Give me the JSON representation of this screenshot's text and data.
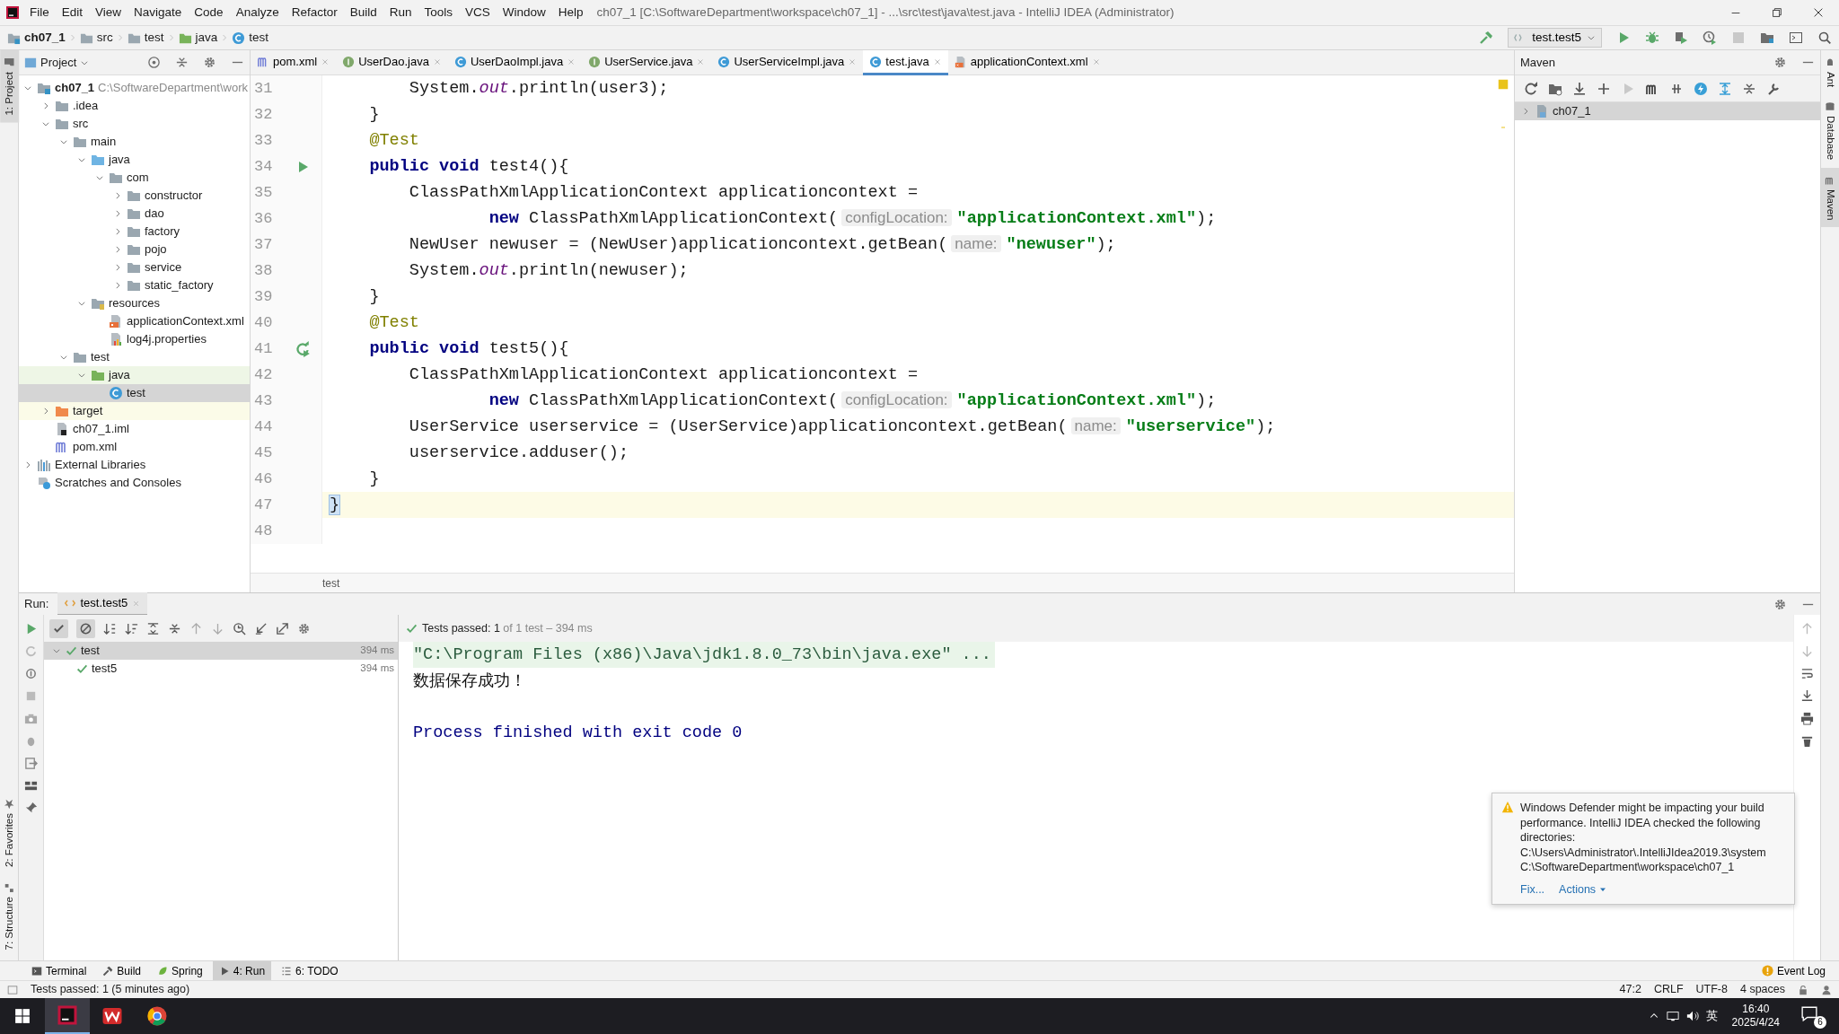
{
  "title_bar": {
    "menu": [
      "File",
      "Edit",
      "View",
      "Navigate",
      "Code",
      "Analyze",
      "Refactor",
      "Build",
      "Run",
      "Tools",
      "VCS",
      "Window",
      "Help"
    ],
    "title": "ch07_1 [C:\\SoftwareDepartment\\workspace\\ch07_1] - ...\\src\\test\\java\\test.java - IntelliJ IDEA (Administrator)"
  },
  "nav_bar": {
    "breadcrumbs": [
      {
        "label": "ch07_1",
        "kind": "module"
      },
      {
        "label": "src",
        "kind": "folder"
      },
      {
        "label": "test",
        "kind": "folder"
      },
      {
        "label": "java",
        "kind": "test-src"
      },
      {
        "label": "test",
        "kind": "class"
      }
    ],
    "run_config": "test.test5"
  },
  "left_stripe": {
    "top": [
      {
        "label": "1: Project",
        "selected": true
      }
    ],
    "bottom": [
      {
        "label": "2: Favorites",
        "selected": false
      },
      {
        "label": "7: Structure",
        "selected": false
      }
    ]
  },
  "right_stripe": [
    {
      "label": "Ant",
      "selected": false
    },
    {
      "label": "Database",
      "selected": false
    },
    {
      "label": "Maven",
      "selected": true
    }
  ],
  "project": {
    "title": "Project",
    "tree": [
      {
        "label": "ch07_1",
        "path": "C:\\SoftwareDepartment\\work",
        "kind": "module",
        "expanded": true,
        "selected": false,
        "children": [
          {
            "label": ".idea",
            "kind": "folder",
            "expanded": false,
            "selected": false
          },
          {
            "label": "src",
            "kind": "folder",
            "expanded": true,
            "selected": false,
            "children": [
              {
                "label": "main",
                "kind": "folder",
                "expanded": true,
                "selected": false,
                "children": [
                  {
                    "label": "java",
                    "kind": "src",
                    "expanded": true,
                    "selected": false,
                    "children": [
                      {
                        "label": "com",
                        "kind": "folder",
                        "expanded": true,
                        "selected": false,
                        "children": [
                          {
                            "label": "constructor",
                            "kind": "folder",
                            "expanded": false,
                            "selected": false
                          },
                          {
                            "label": "dao",
                            "kind": "folder",
                            "expanded": false,
                            "selected": false
                          },
                          {
                            "label": "factory",
                            "kind": "folder",
                            "expanded": false,
                            "selected": false
                          },
                          {
                            "label": "pojo",
                            "kind": "folder",
                            "expanded": false,
                            "selected": false
                          },
                          {
                            "label": "service",
                            "kind": "folder",
                            "expanded": false,
                            "selected": false
                          },
                          {
                            "label": "static_factory",
                            "kind": "folder",
                            "expanded": false,
                            "selected": false
                          }
                        ]
                      }
                    ]
                  },
                  {
                    "label": "resources",
                    "kind": "resources",
                    "expanded": true,
                    "selected": false,
                    "children": [
                      {
                        "label": "applicationContext.xml",
                        "kind": "xml",
                        "selected": false
                      },
                      {
                        "label": "log4j.properties",
                        "kind": "properties",
                        "selected": false
                      }
                    ]
                  }
                ]
              },
              {
                "label": "test",
                "kind": "folder",
                "expanded": true,
                "selected": false,
                "children": [
                  {
                    "label": "java",
                    "kind": "test-src",
                    "expanded": true,
                    "selected": false,
                    "children": [
                      {
                        "label": "test",
                        "kind": "class",
                        "selected": true
                      }
                    ]
                  }
                ]
              }
            ]
          },
          {
            "label": "target",
            "kind": "excluded",
            "expanded": false,
            "selected": false
          },
          {
            "label": "ch07_1.iml",
            "kind": "iml",
            "selected": false
          },
          {
            "label": "pom.xml",
            "kind": "maven",
            "selected": false
          }
        ]
      },
      {
        "label": "External Libraries",
        "kind": "libraries",
        "expanded": false,
        "selected": false
      },
      {
        "label": "Scratches and Consoles",
        "kind": "scratches",
        "selected": false
      }
    ]
  },
  "editor": {
    "tabs": [
      {
        "label": "pom.xml",
        "kind": "maven",
        "selected": false
      },
      {
        "label": "UserDao.java",
        "kind": "interface",
        "selected": false
      },
      {
        "label": "UserDaoImpl.java",
        "kind": "class",
        "selected": false
      },
      {
        "label": "UserService.java",
        "kind": "interface",
        "selected": false
      },
      {
        "label": "UserServiceImpl.java",
        "kind": "class",
        "selected": false
      },
      {
        "label": "test.java",
        "kind": "class",
        "selected": true
      },
      {
        "label": "applicationContext.xml",
        "kind": "xml",
        "selected": false
      }
    ],
    "lines": [
      {
        "number": "31",
        "current": false,
        "segments": [
          {
            "kind": "plain",
            "text": "        System."
          },
          {
            "kind": "field",
            "text": "out"
          },
          {
            "kind": "plain",
            "text": ".println(user3);"
          }
        ]
      },
      {
        "number": "32",
        "current": false,
        "segments": [
          {
            "kind": "plain",
            "text": "    }"
          }
        ]
      },
      {
        "number": "33",
        "current": false,
        "segments": [
          {
            "kind": "ann",
            "text": "    @Test"
          }
        ]
      },
      {
        "number": "34",
        "current": false,
        "kind": "run",
        "segments": [
          {
            "kind": "kw",
            "text": "    public void "
          },
          {
            "kind": "plain",
            "text": "test4(){"
          }
        ]
      },
      {
        "number": "35",
        "current": false,
        "segments": [
          {
            "kind": "plain",
            "text": "        ClassPathXmlApplicationContext applicationcontext ="
          }
        ]
      },
      {
        "number": "36",
        "current": false,
        "segments": [
          {
            "kind": "kw",
            "text": "                new "
          },
          {
            "kind": "plain",
            "text": "ClassPathXmlApplicationContext("
          },
          {
            "kind": "hint",
            "text": "configLocation:"
          },
          {
            "kind": "str",
            "text": "\"applicationContext.xml\""
          },
          {
            "kind": "plain",
            "text": ");"
          }
        ]
      },
      {
        "number": "37",
        "current": false,
        "segments": [
          {
            "kind": "plain",
            "text": "        NewUser newuser = (NewUser)applicationcontext.getBean("
          },
          {
            "kind": "hint",
            "text": "name:"
          },
          {
            "kind": "str",
            "text": "\"newuser\""
          },
          {
            "kind": "plain",
            "text": ");"
          }
        ]
      },
      {
        "number": "38",
        "current": false,
        "segments": [
          {
            "kind": "plain",
            "text": "        System."
          },
          {
            "kind": "field",
            "text": "out"
          },
          {
            "kind": "plain",
            "text": ".println(newuser);"
          }
        ]
      },
      {
        "number": "39",
        "current": false,
        "segments": [
          {
            "kind": "plain",
            "text": "    }"
          }
        ]
      },
      {
        "number": "40",
        "current": false,
        "segments": [
          {
            "kind": "ann",
            "text": "    @Test"
          }
        ]
      },
      {
        "number": "41",
        "current": false,
        "kind": "rerun",
        "segments": [
          {
            "kind": "kw",
            "text": "    public void "
          },
          {
            "kind": "plain",
            "text": "test5(){"
          }
        ]
      },
      {
        "number": "42",
        "current": false,
        "segments": [
          {
            "kind": "plain",
            "text": "        ClassPathXmlApplicationContext applicationcontext ="
          }
        ]
      },
      {
        "number": "43",
        "current": false,
        "segments": [
          {
            "kind": "kw",
            "text": "                new "
          },
          {
            "kind": "plain",
            "text": "ClassPathXmlApplicationContext("
          },
          {
            "kind": "hint",
            "text": "configLocation:"
          },
          {
            "kind": "str",
            "text": "\"applicationContext.xml\""
          },
          {
            "kind": "plain",
            "text": ");"
          }
        ]
      },
      {
        "number": "44",
        "current": false,
        "segments": [
          {
            "kind": "plain",
            "text": "        UserService userservice = (UserService)applicationcontext.getBean("
          },
          {
            "kind": "hint",
            "text": "name:"
          },
          {
            "kind": "str",
            "text": "\"userservice\""
          },
          {
            "kind": "plain",
            "text": ");"
          }
        ]
      },
      {
        "number": "45",
        "current": false,
        "segments": [
          {
            "kind": "plain",
            "text": "        userservice.adduser();"
          }
        ]
      },
      {
        "number": "46",
        "current": false,
        "segments": [
          {
            "kind": "plain",
            "text": "    }"
          }
        ]
      },
      {
        "number": "47",
        "current": true,
        "segments": [
          {
            "kind": "brace",
            "text": "}"
          }
        ]
      },
      {
        "number": "48",
        "current": false
      }
    ],
    "breadcrumb": "test"
  },
  "maven": {
    "title": "Maven",
    "tree": [
      {
        "label": "ch07_1",
        "expanded": false,
        "selected": true
      }
    ]
  },
  "run": {
    "label": "Run:",
    "tab": "test.test5",
    "status": "**Tests passed: 1** of 1 test – 394 ms",
    "tests": [
      {
        "label": "test",
        "time": "394 ms",
        "selected": true,
        "expanded": true,
        "children": [
          {
            "label": "test5",
            "time": "394 ms",
            "selected": false
          }
        ]
      }
    ],
    "console": [
      {
        "kind": "command",
        "text": "\"C:\\Program Files (x86)\\Java\\jdk1.8.0_73\\bin\\java.exe\" ..."
      },
      {
        "kind": "output",
        "text": "数据保存成功！"
      },
      {
        "kind": "exit",
        "text": "Process finished with exit code 0"
      }
    ]
  },
  "notification": {
    "message": "Windows Defender might be impacting your build performance. IntelliJ IDEA checked the following directories:",
    "paths": [
      "C:\\Users\\Administrator\\.IntelliJIdea2019.3\\system",
      "C:\\SoftwareDepartment\\workspace\\ch07_1"
    ],
    "links": [
      "Fix...",
      "Actions"
    ]
  },
  "tool_buttons": [
    {
      "label": "Terminal",
      "kind": "terminal",
      "selected": false
    },
    {
      "label": "Build",
      "kind": "build",
      "selected": false
    },
    {
      "label": "Spring",
      "kind": "spring",
      "selected": false
    },
    {
      "label": "4: Run",
      "kind": "run",
      "selected": true
    },
    {
      "label": "6: TODO",
      "kind": "todo",
      "selected": false
    }
  ],
  "event_log": "Event Log",
  "status_bar": {
    "message": "Tests passed: 1 (5 minutes ago)",
    "items": [
      "47:2",
      "CRLF",
      "UTF-8",
      "4 spaces"
    ]
  },
  "taskbar": {
    "ime": "英",
    "time": "16:40",
    "date": "2025/4/24",
    "notifications": "6"
  }
}
